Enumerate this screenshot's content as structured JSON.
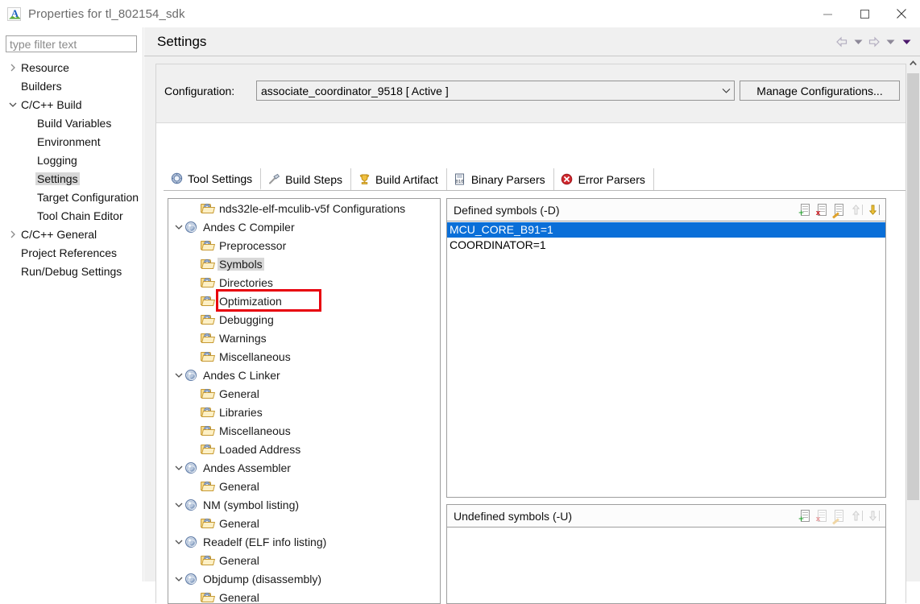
{
  "window": {
    "title": "Properties for tl_802154_sdk",
    "app_icon": "andes-a-icon",
    "controls": [
      {
        "name": "minimize-button",
        "glyph": "minimize-icon"
      },
      {
        "name": "maximize-button",
        "glyph": "maximize-icon"
      },
      {
        "name": "close-button",
        "glyph": "close-icon"
      }
    ]
  },
  "sidebar": {
    "filter_placeholder": "type filter text",
    "filter_value": "",
    "items": [
      {
        "label": "Resource",
        "indent": 1,
        "arrow": "collapsed",
        "selected": false
      },
      {
        "label": "Builders",
        "indent": 2,
        "arrow": "none",
        "selected": false
      },
      {
        "label": "C/C++ Build",
        "indent": 1,
        "arrow": "expanded",
        "selected": false
      },
      {
        "label": "Build Variables",
        "indent": 3,
        "arrow": "none",
        "selected": false
      },
      {
        "label": "Environment",
        "indent": 3,
        "arrow": "none",
        "selected": false
      },
      {
        "label": "Logging",
        "indent": 3,
        "arrow": "none",
        "selected": false
      },
      {
        "label": "Settings",
        "indent": 3,
        "arrow": "none",
        "selected": true
      },
      {
        "label": "Target Configuration",
        "indent": 3,
        "arrow": "none",
        "selected": false
      },
      {
        "label": "Tool Chain Editor",
        "indent": 3,
        "arrow": "none",
        "selected": false
      },
      {
        "label": "C/C++ General",
        "indent": 1,
        "arrow": "collapsed",
        "selected": false
      },
      {
        "label": "Project References",
        "indent": 2,
        "arrow": "none",
        "selected": false
      },
      {
        "label": "Run/Debug Settings",
        "indent": 2,
        "arrow": "none",
        "selected": false
      }
    ]
  },
  "page": {
    "title": "Settings",
    "nav_buttons": [
      {
        "name": "back-button",
        "icon": "arrow-left-icon",
        "enabled": false
      },
      {
        "name": "back-dropdown",
        "icon": "chevron-down-icon",
        "enabled": false
      },
      {
        "name": "forward-button",
        "icon": "arrow-right-icon",
        "enabled": false
      },
      {
        "name": "forward-dropdown",
        "icon": "chevron-down-icon",
        "enabled": false
      },
      {
        "name": "view-menu-dropdown",
        "icon": "chevron-down-icon",
        "enabled": true
      }
    ],
    "configuration": {
      "label": "Configuration:",
      "value": "associate_coordinator_9518  [ Active ]",
      "manage_button": "Manage Configurations..."
    },
    "tabs": [
      {
        "label": "Tool Settings",
        "icon": "tool-gear-icon",
        "active": true
      },
      {
        "label": "Build Steps",
        "icon": "hammer-icon",
        "active": false
      },
      {
        "label": "Build Artifact",
        "icon": "trophy-icon",
        "active": false
      },
      {
        "label": "Binary Parsers",
        "icon": "binary-file-icon",
        "active": false
      },
      {
        "label": "Error Parsers",
        "icon": "error-circle-icon",
        "active": false
      }
    ]
  },
  "tool_tree": {
    "items": [
      {
        "label": "nds32le-elf-mculib-v5f Configurations",
        "indent": 1,
        "arrow": "none",
        "icon": "folder-option-icon",
        "selected": false
      },
      {
        "label": "Andes C Compiler",
        "indent": 0,
        "arrow": "expanded",
        "icon": "tool-gear-icon",
        "selected": false
      },
      {
        "label": "Preprocessor",
        "indent": 1,
        "arrow": "none",
        "icon": "folder-option-icon",
        "selected": false
      },
      {
        "label": "Symbols",
        "indent": 1,
        "arrow": "none",
        "icon": "folder-option-icon",
        "selected": true
      },
      {
        "label": "Directories",
        "indent": 1,
        "arrow": "none",
        "icon": "folder-option-icon",
        "selected": false
      },
      {
        "label": "Optimization",
        "indent": 1,
        "arrow": "none",
        "icon": "folder-option-icon",
        "selected": false
      },
      {
        "label": "Debugging",
        "indent": 1,
        "arrow": "none",
        "icon": "folder-option-icon",
        "selected": false
      },
      {
        "label": "Warnings",
        "indent": 1,
        "arrow": "none",
        "icon": "folder-option-icon",
        "selected": false
      },
      {
        "label": "Miscellaneous",
        "indent": 1,
        "arrow": "none",
        "icon": "folder-option-icon",
        "selected": false
      },
      {
        "label": "Andes C Linker",
        "indent": 0,
        "arrow": "expanded",
        "icon": "tool-gear-icon",
        "selected": false
      },
      {
        "label": "General",
        "indent": 1,
        "arrow": "none",
        "icon": "folder-option-icon",
        "selected": false
      },
      {
        "label": "Libraries",
        "indent": 1,
        "arrow": "none",
        "icon": "folder-option-icon",
        "selected": false
      },
      {
        "label": "Miscellaneous",
        "indent": 1,
        "arrow": "none",
        "icon": "folder-option-icon",
        "selected": false
      },
      {
        "label": "Loaded Address",
        "indent": 1,
        "arrow": "none",
        "icon": "folder-option-icon",
        "selected": false
      },
      {
        "label": "Andes Assembler",
        "indent": 0,
        "arrow": "expanded",
        "icon": "tool-gear-icon",
        "selected": false
      },
      {
        "label": "General",
        "indent": 1,
        "arrow": "none",
        "icon": "folder-option-icon",
        "selected": false
      },
      {
        "label": "NM (symbol listing)",
        "indent": 0,
        "arrow": "expanded",
        "icon": "tool-gear-icon",
        "selected": false
      },
      {
        "label": "General",
        "indent": 1,
        "arrow": "none",
        "icon": "folder-option-icon",
        "selected": false
      },
      {
        "label": "Readelf (ELF info listing)",
        "indent": 0,
        "arrow": "expanded",
        "icon": "tool-gear-icon",
        "selected": false
      },
      {
        "label": "General",
        "indent": 1,
        "arrow": "none",
        "icon": "folder-option-icon",
        "selected": false
      },
      {
        "label": "Objdump (disassembly)",
        "indent": 0,
        "arrow": "expanded",
        "icon": "tool-gear-icon",
        "selected": false
      },
      {
        "label": "General",
        "indent": 1,
        "arrow": "none",
        "icon": "folder-option-icon",
        "selected": false
      }
    ],
    "annotation": {
      "name": "red-highlight-box",
      "target": "Symbols",
      "color": "#e8000d"
    }
  },
  "defined_symbols": {
    "title": "Defined symbols (-D)",
    "toolbar": [
      {
        "name": "add-symbol-button",
        "icon": "add-icon",
        "enabled": true
      },
      {
        "name": "delete-symbol-button",
        "icon": "delete-icon",
        "enabled": true
      },
      {
        "name": "edit-symbol-button",
        "icon": "edit-icon",
        "enabled": true
      },
      {
        "name": "move-up-button",
        "icon": "arrow-up-icon",
        "enabled": false
      },
      {
        "name": "move-down-button",
        "icon": "arrow-down-icon",
        "enabled": true
      }
    ],
    "rows": [
      {
        "value": "MCU_CORE_B91=1",
        "selected": true
      },
      {
        "value": "COORDINATOR=1",
        "selected": false
      }
    ]
  },
  "undefined_symbols": {
    "title": "Undefined symbols (-U)",
    "toolbar": [
      {
        "name": "add-symbol-button",
        "icon": "add-icon",
        "enabled": true
      },
      {
        "name": "delete-symbol-button",
        "icon": "delete-icon",
        "enabled": false
      },
      {
        "name": "edit-symbol-button",
        "icon": "edit-icon",
        "enabled": false
      },
      {
        "name": "move-up-button",
        "icon": "arrow-up-icon",
        "enabled": false
      },
      {
        "name": "move-down-button",
        "icon": "arrow-down-icon",
        "enabled": false
      }
    ],
    "rows": []
  },
  "colors": {
    "selection_blue": "#0a6fd8",
    "annotation_red": "#e8000d",
    "tree_selection_grey": "#d8d8d8"
  }
}
